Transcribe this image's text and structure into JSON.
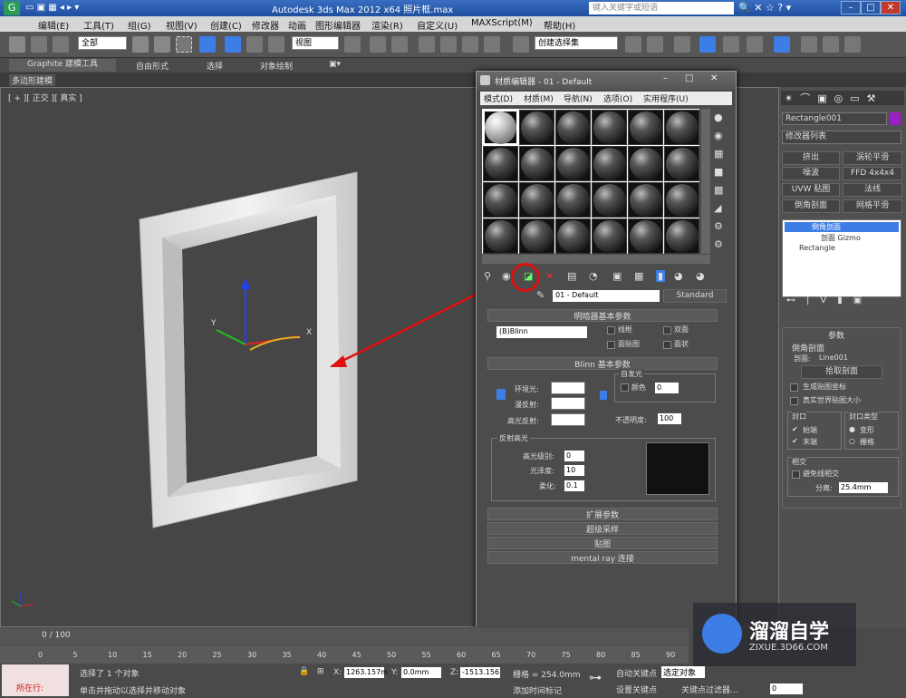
{
  "window": {
    "title": "Autodesk 3ds Max 2012 x64    照片框.max",
    "search_placeholder": "键入关键字或短语"
  },
  "menu": [
    "编辑(E)",
    "工具(T)",
    "组(G)",
    "视图(V)",
    "创建(C)",
    "修改器",
    "动画",
    "图形编辑器",
    "渲染(R)",
    "自定义(U)",
    "MAXScript(M)",
    "帮助(H)"
  ],
  "toolbar": {
    "selection_filter": "全部",
    "view_dropdown": "视图",
    "named_selection": "创建选择集"
  },
  "ribbon": {
    "tabs": [
      "Graphite 建模工具",
      "自由形式",
      "选择",
      "对象绘制"
    ],
    "sub": "多边形建模"
  },
  "viewport": {
    "label": "[ + ][ 正交 ][ 真实 ]"
  },
  "material_editor": {
    "title": "材质编辑器 - 01 - Default",
    "menu": [
      "模式(D)",
      "材质(M)",
      "导航(N)",
      "选项(O)",
      "实用程序(U)"
    ],
    "material_name": "01 - Default",
    "material_type": "Standard",
    "shader_rollout": "明暗器基本参数",
    "shader": "(B)Blinn",
    "shader_opts": [
      "线框",
      "双面",
      "面贴图",
      "面状"
    ],
    "blinn_rollout": "Blinn 基本参数",
    "self_illum": "自发光",
    "color_label": "颜色",
    "color_value": "0",
    "ambient": "环境光:",
    "diffuse": "漫反射:",
    "specular": "高光反射:",
    "opacity_label": "不透明度:",
    "opacity": "100",
    "spec_section": "反射高光",
    "spec_level_label": "高光级别:",
    "spec_level": "0",
    "gloss_label": "光泽度:",
    "gloss": "10",
    "soften_label": "柔化:",
    "soften": "0.1",
    "rollouts": [
      "扩展参数",
      "超级采样",
      "贴图",
      "mental ray 连接"
    ]
  },
  "right_panel": {
    "object_name": "Rectangle001",
    "modifier_list": "修改器列表",
    "buttons": [
      "挤出",
      "涡轮平滑",
      "噪波",
      "FFD 4x4x4",
      "UVW 贴图",
      "法线",
      "倒角剖面",
      "网格平滑"
    ],
    "stack": [
      "倒角剖面",
      "剖面 Gizmo",
      "Rectangle"
    ],
    "params_title": "参数",
    "bevel_profile": "倒角剖面",
    "profile_label": "剖面:",
    "profile_value": "Line001",
    "pick_profile": "拾取剖面",
    "gen_map": "生成贴图坐标",
    "real_world": "真实世界贴图大小",
    "caps": "封口",
    "start": "始端",
    "end": "末端",
    "cap_type": "封口类型",
    "morph": "变形",
    "grid": "栅格",
    "intersect": "相交",
    "avoid": "避免线相交",
    "sep_label": "分离:",
    "sep_value": "25.4mm"
  },
  "status": {
    "frame": "0 / 100",
    "ticks": [
      "0",
      "5",
      "10",
      "15",
      "20",
      "25",
      "30",
      "35",
      "40",
      "45",
      "50",
      "55",
      "60",
      "65",
      "70",
      "75",
      "80",
      "85",
      "90"
    ],
    "selected": "选择了 1 个对象",
    "hint": "单击并拖动以选择并移动对象",
    "mode": "所在行:",
    "x": "1263.157m",
    "y": "0.0mm",
    "z": "-1513.156",
    "grid": "栅格 = 254.0mm",
    "auto_key": "自动关键点",
    "selected_obj": "选定对象",
    "set_key": "设置关键点",
    "key_filter": "关键点过滤器...",
    "add_time_tag": "添加时间标记",
    "spinner": "0"
  },
  "logo": {
    "name": "溜溜自学",
    "url": "ZIXUE.3D66.COM"
  },
  "colors": {
    "accent_red": "#e01010",
    "selection_blue": "#2c5ca9"
  }
}
